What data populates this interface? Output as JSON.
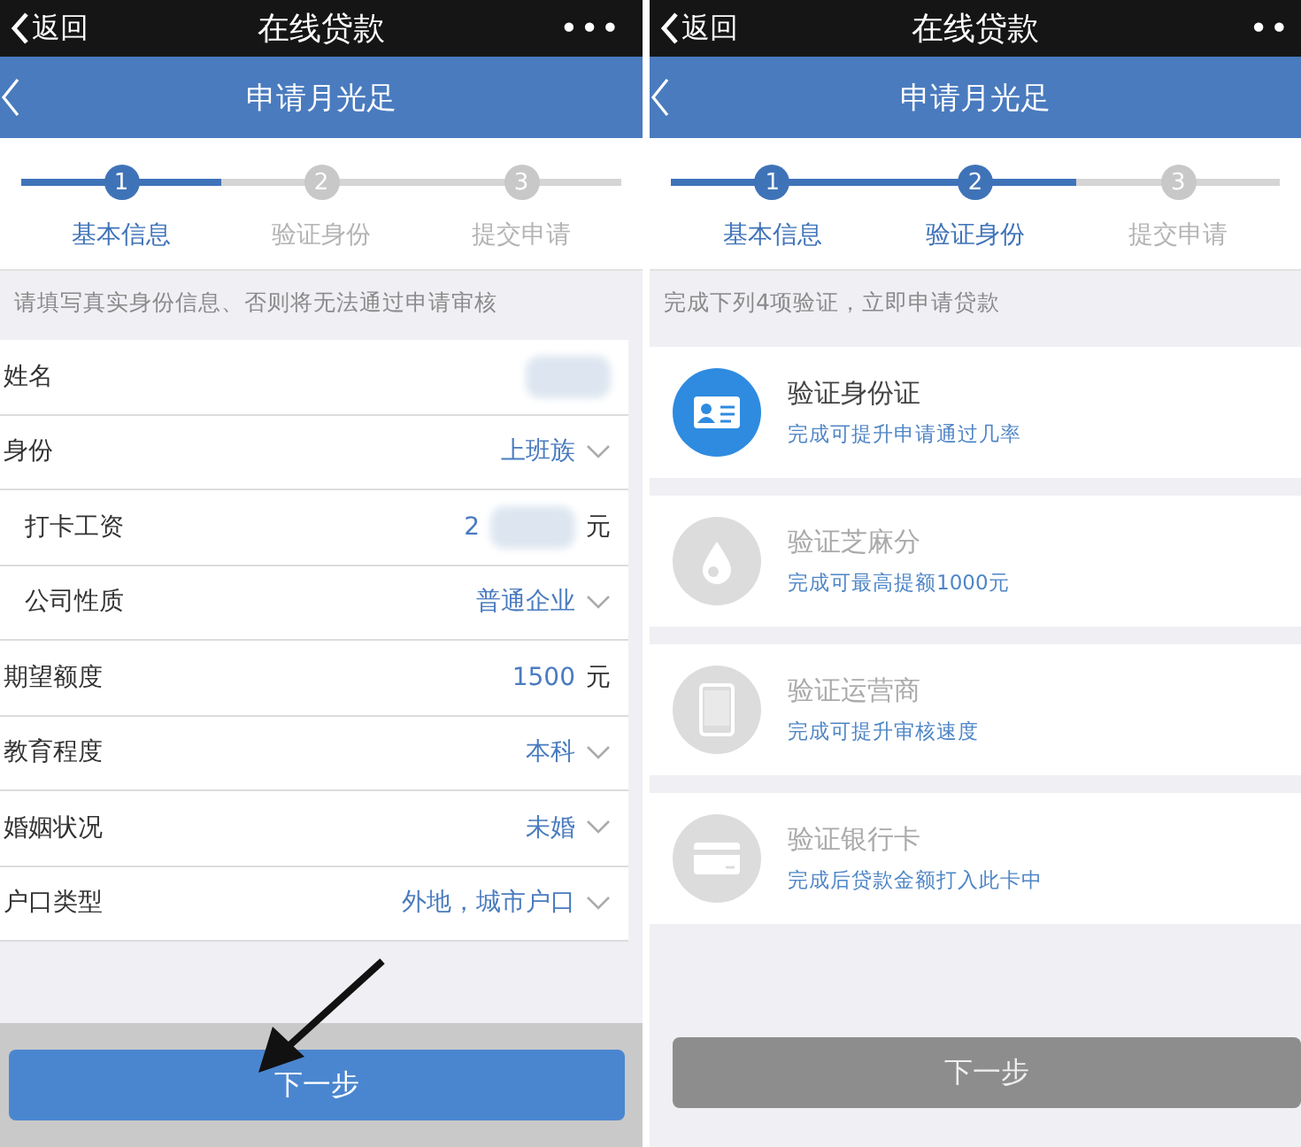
{
  "panels": [
    {
      "status_bar": {
        "back": "返回",
        "title": "在线贷款",
        "more": "•••"
      },
      "header": {
        "title": "申请月光足"
      },
      "steps": [
        {
          "number": "1",
          "label": "基本信息",
          "active": true
        },
        {
          "number": "2",
          "label": "验证身份",
          "active": false
        },
        {
          "number": "3",
          "label": "提交申请",
          "active": false
        }
      ],
      "notice": "请填写真实身份信息、否则将无法通过申请审核",
      "form": [
        {
          "label": "姓名",
          "kind": "redacted"
        },
        {
          "label": "身份",
          "kind": "select",
          "value": "上班族",
          "children": [
            {
              "label": "打卡工资",
              "kind": "amount",
              "value": "2",
              "redacted": true,
              "unit": "元"
            },
            {
              "label": "公司性质",
              "kind": "select",
              "value": "普通企业"
            }
          ]
        },
        {
          "label": "期望额度",
          "kind": "amount",
          "value": "1500",
          "unit": "元"
        },
        {
          "label": "教育程度",
          "kind": "select",
          "value": "本科"
        },
        {
          "label": "婚姻状况",
          "kind": "select",
          "value": "未婚"
        },
        {
          "label": "户口类型",
          "kind": "select",
          "value": "外地，城市户口"
        }
      ],
      "button": {
        "label": "下一步",
        "disabled": false
      }
    },
    {
      "status_bar": {
        "back": "返回",
        "title": "在线贷款",
        "more": "••"
      },
      "header": {
        "title": "申请月光足"
      },
      "steps": [
        {
          "number": "1",
          "label": "基本信息",
          "active": true
        },
        {
          "number": "2",
          "label": "验证身份",
          "active": true
        },
        {
          "number": "3",
          "label": "提交申请",
          "active": false
        }
      ],
      "notice": "完成下列4项验证，立即申请贷款",
      "verifications": [
        {
          "kind": "id-card",
          "title": "验证身份证",
          "subtitle": "完成可提升申请通过几率",
          "active": true
        },
        {
          "kind": "drop",
          "title": "验证芝麻分",
          "subtitle": "完成可最高提额1000元",
          "active": false
        },
        {
          "kind": "phone",
          "title": "验证运营商",
          "subtitle": "完成可提升审核速度",
          "active": false
        },
        {
          "kind": "card",
          "title": "验证银行卡",
          "subtitle": "完成后贷款金额打入此卡中",
          "active": false
        }
      ],
      "button": {
        "label": "下一步",
        "disabled": true
      }
    }
  ]
}
